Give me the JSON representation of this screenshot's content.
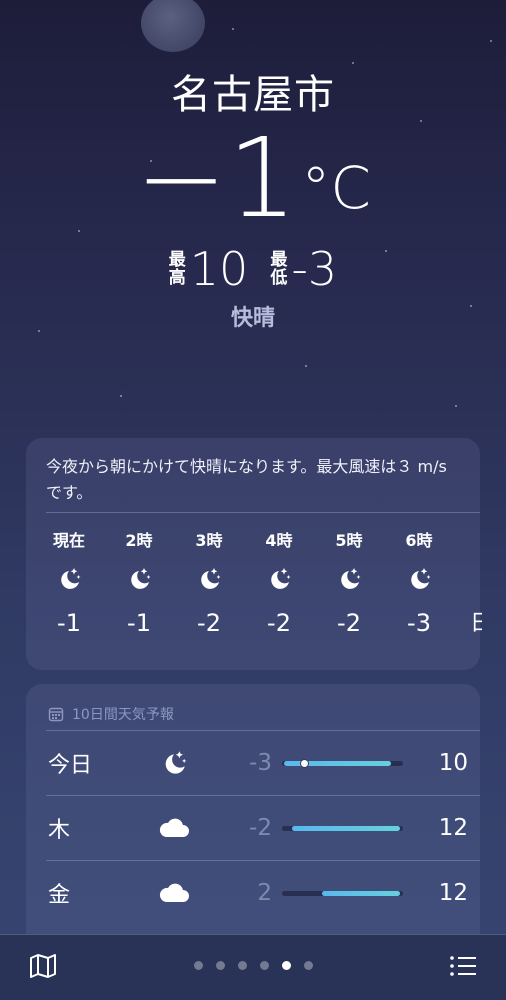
{
  "location": {
    "city": "名古屋市"
  },
  "current": {
    "temperature": "−1",
    "unit": "°C",
    "high_label_1": "最",
    "high_label_2": "高",
    "high": "10",
    "low_label_1": "最",
    "low_label_2": "低",
    "low": "-3",
    "condition": "快晴"
  },
  "hourly": {
    "summary": "今夜から朝にかけて快晴になります。最大風速は３ m/sです。",
    "items": [
      {
        "time": "現在",
        "icon": "moon-stars-icon",
        "temp": "-1"
      },
      {
        "time": "2時",
        "icon": "moon-stars-icon",
        "temp": "-1"
      },
      {
        "time": "3時",
        "icon": "moon-stars-icon",
        "temp": "-2"
      },
      {
        "time": "4時",
        "icon": "moon-stars-icon",
        "temp": "-2"
      },
      {
        "time": "5時",
        "icon": "moon-stars-icon",
        "temp": "-2"
      },
      {
        "time": "6時",
        "icon": "moon-stars-icon",
        "temp": "-3"
      }
    ],
    "cut_off_text": "日"
  },
  "forecast": {
    "title": "10日間天気予報",
    "days": [
      {
        "day": "今日",
        "icon": "moon-stars-icon",
        "low": "-3",
        "high": "10",
        "range_start": 0.02,
        "range_end": 0.9,
        "current_marker": 0.18
      },
      {
        "day": "木",
        "icon": "cloud-icon",
        "low": "-2",
        "high": "12",
        "range_start": 0.08,
        "range_end": 0.98
      },
      {
        "day": "金",
        "icon": "cloud-icon",
        "low": "2",
        "high": "12",
        "range_start": 0.33,
        "range_end": 0.98
      }
    ]
  },
  "pages": {
    "count": 6,
    "active_index": 4
  },
  "colors": {
    "accent_range": "#5ab8ee",
    "range_teal": "#66d0dc"
  },
  "icons": {
    "map": "map-icon",
    "list": "list-icon",
    "calendar": "calendar-icon"
  }
}
